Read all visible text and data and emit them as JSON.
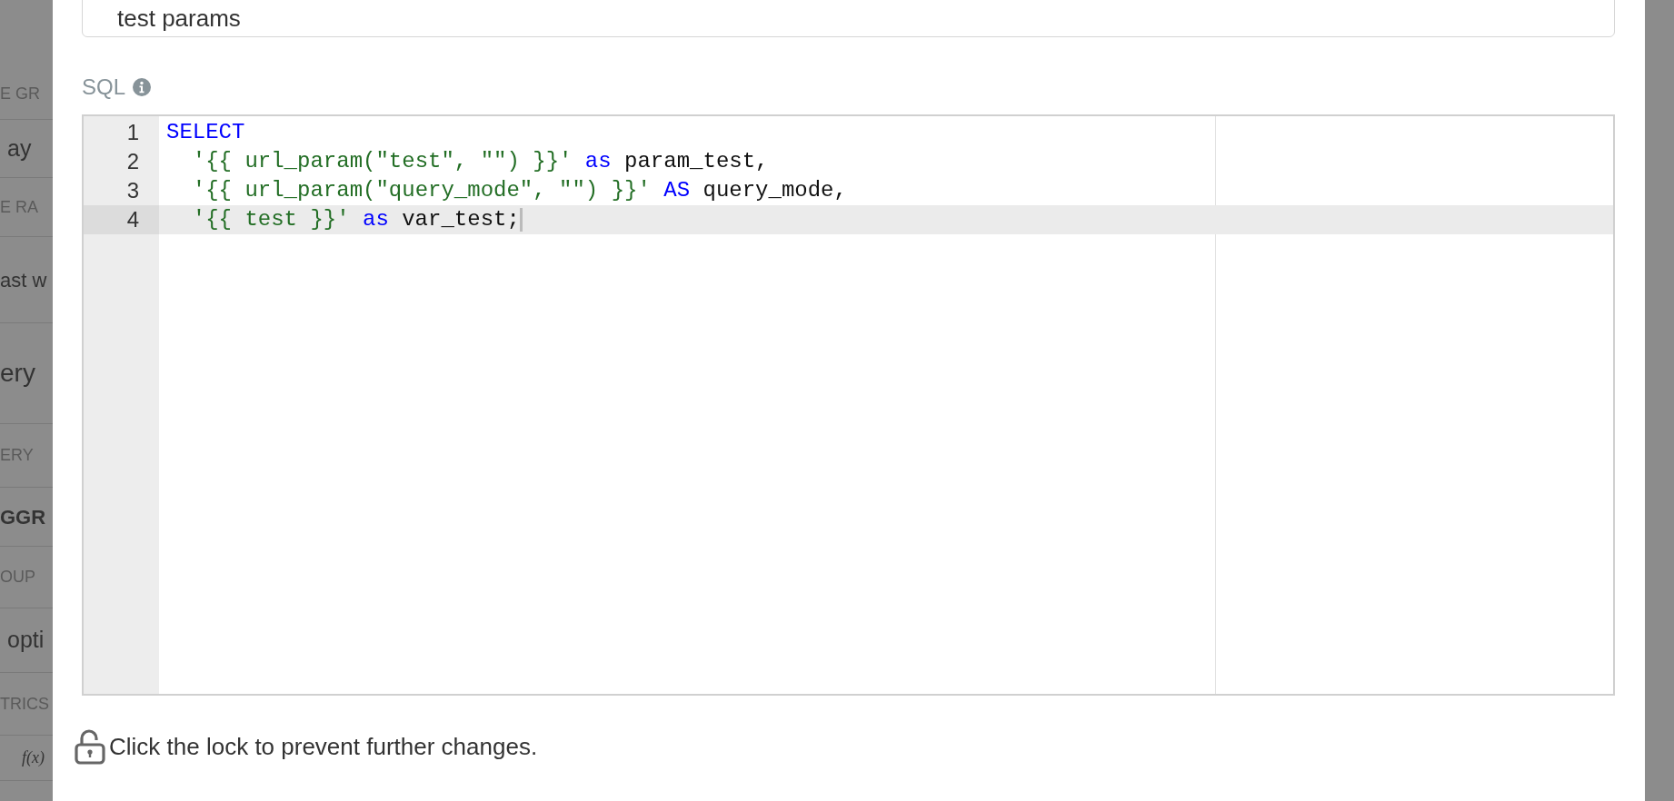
{
  "background_panel": {
    "items": [
      {
        "kind": "label",
        "text": "E GR"
      },
      {
        "kind": "value",
        "text": "ay"
      },
      {
        "kind": "label",
        "text": "E RA"
      },
      {
        "kind": "field",
        "text": "ast w"
      },
      {
        "kind": "big",
        "text": "ery"
      },
      {
        "kind": "label",
        "text": "ERY"
      },
      {
        "kind": "bold",
        "text": "GGR"
      },
      {
        "kind": "label",
        "text": "OUP"
      },
      {
        "kind": "value",
        "text": "opti"
      },
      {
        "kind": "label",
        "text": "TRICS"
      },
      {
        "kind": "fx",
        "text": "f(x)"
      }
    ]
  },
  "params_field": {
    "value": "test params"
  },
  "sql_label": "SQL",
  "editor": {
    "lines": [
      {
        "number": "1",
        "active": false,
        "indented": false,
        "tokens": [
          {
            "kind": "keyword",
            "text": "SELECT"
          }
        ]
      },
      {
        "number": "2",
        "active": false,
        "indented": true,
        "tokens": [
          {
            "kind": "string",
            "text": "'{{ url_param(\"test\", \"\") }}'"
          },
          {
            "kind": "keyword",
            "text": "as"
          },
          {
            "kind": "plain",
            "text": "param_test,"
          }
        ]
      },
      {
        "number": "3",
        "active": false,
        "indented": true,
        "tokens": [
          {
            "kind": "string",
            "text": "'{{ url_param(\"query_mode\", \"\") }}'"
          },
          {
            "kind": "keyword",
            "text": "AS"
          },
          {
            "kind": "plain",
            "text": "query_mode,"
          }
        ]
      },
      {
        "number": "4",
        "active": true,
        "indented": true,
        "tokens": [
          {
            "kind": "string",
            "text": "'{{ test }}'"
          },
          {
            "kind": "keyword",
            "text": "as"
          },
          {
            "kind": "plain",
            "text": "var_test;"
          }
        ]
      }
    ]
  },
  "lock_message": "Click the lock to prevent further changes."
}
